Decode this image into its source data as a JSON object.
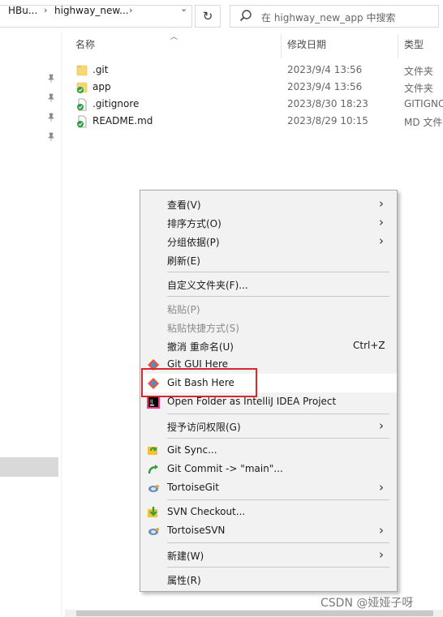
{
  "address_bar": {
    "crumbs": [
      "HBu...",
      "highway_new..."
    ],
    "separator": "›",
    "dropdown": "⌄",
    "refresh": "↻"
  },
  "search": {
    "placeholder": "在 highway_new_app 中搜索"
  },
  "columns": {
    "name": "名称",
    "date": "修改日期",
    "type": "类型"
  },
  "files": [
    {
      "name": ".git",
      "date": "2023/9/4 13:56",
      "type": "文件夹",
      "icon": "folder-icon"
    },
    {
      "name": "app",
      "date": "2023/9/4 13:56",
      "type": "文件夹",
      "icon": "folder-git-ok-icon"
    },
    {
      "name": ".gitignore",
      "date": "2023/8/30 18:23",
      "type": "GITIGNORE",
      "icon": "file-git-ok-icon"
    },
    {
      "name": "README.md",
      "date": "2023/8/29 10:15",
      "type": "MD 文件",
      "icon": "file-git-ok-icon"
    }
  ],
  "context_menu": {
    "view": "查看(V)",
    "sort": "排序方式(O)",
    "group": "分组依据(P)",
    "refresh": "刷新(E)",
    "customize": "自定义文件夹(F)...",
    "paste": "粘贴(P)",
    "paste_shortcut": "粘贴快捷方式(S)",
    "undo": "撤消 重命名(U)",
    "undo_shortcut": "Ctrl+Z",
    "git_gui": "Git GUI Here",
    "git_bash": "Git Bash Here",
    "intellij": "Open Folder as IntelliJ IDEA Project",
    "grant_access": "授予访问权限(G)",
    "git_sync": "Git Sync...",
    "git_commit": "Git Commit -> \"main\"...",
    "tortoise_git": "TortoiseGit",
    "svn_checkout": "SVN Checkout...",
    "tortoise_svn": "TortoiseSVN",
    "new": "新建(W)",
    "properties": "属性(R)",
    "submenu_arrow": "›"
  },
  "watermark": "CSDN @娅娅子呀",
  "colors": {
    "highlight_border": "#d9272e",
    "menu_bg": "#f2f2f2",
    "git_ok_green": "#2e9e3f"
  }
}
